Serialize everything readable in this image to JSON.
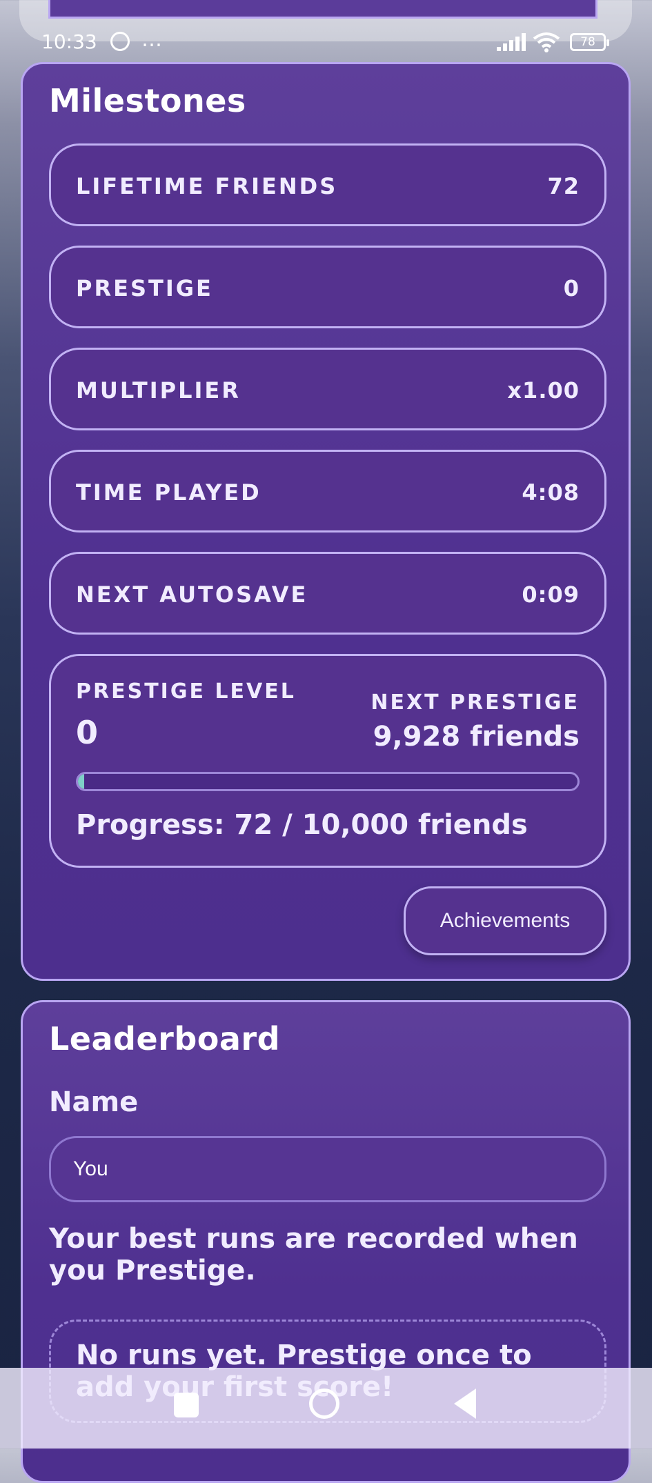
{
  "status_bar": {
    "time": "10:33",
    "dots": "…",
    "battery": "78"
  },
  "milestones": {
    "title": "Milestones",
    "rows": [
      {
        "label": "LIFETIME FRIENDS",
        "value": "72"
      },
      {
        "label": "PRESTIGE",
        "value": "0"
      },
      {
        "label": "MULTIPLIER",
        "value": "x1.00"
      },
      {
        "label": "TIME PLAYED",
        "value": "4:08"
      },
      {
        "label": "NEXT AUTOSAVE",
        "value": "0:09"
      }
    ],
    "prestige": {
      "level_label": "PRESTIGE LEVEL",
      "level_value": "0",
      "next_label": "NEXT PRESTIGE",
      "next_value": "9,928 friends",
      "progress_fraction": 0.0072,
      "progress_text": "Progress: 72 / 10,000 friends"
    },
    "achievements_button": "Achievements"
  },
  "leaderboard": {
    "title": "Leaderboard",
    "name_label": "Name",
    "name_value": "You",
    "info": "Your best runs are recorded when you Prestige.",
    "empty_text": "No runs yet. Prestige once to add your first score!"
  },
  "colors": {
    "panel": "#4f3090",
    "border": "#b9a6f2",
    "progress_fill": "#7fd0c8"
  }
}
